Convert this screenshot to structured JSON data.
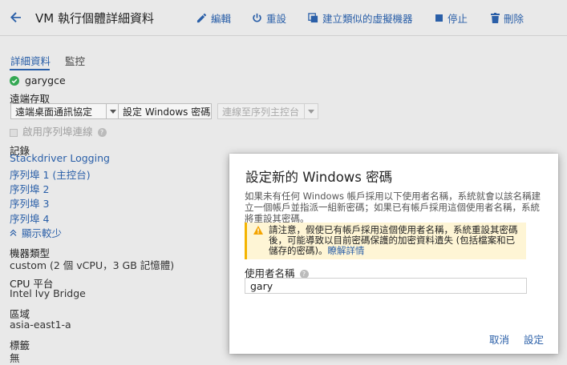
{
  "header": {
    "title": "VM 執行個體詳細資料",
    "actions": [
      {
        "label": "編輯",
        "icon": "pencil-icon"
      },
      {
        "label": "重設",
        "icon": "power-icon"
      },
      {
        "label": "建立類似的虛擬機器",
        "icon": "copy-icon"
      },
      {
        "label": "停止",
        "icon": "stop-icon"
      },
      {
        "label": "刪除",
        "icon": "trash-icon"
      }
    ]
  },
  "tabs": [
    {
      "label": "詳細資料",
      "active": true
    },
    {
      "label": "監控",
      "active": false
    }
  ],
  "instance": {
    "name": "garygce",
    "status_color": "#34a853"
  },
  "remote": {
    "section_label": "遠端存取",
    "rdp_button": "遠端桌面通訊協定",
    "set_password_button": "設定 Windows 密碼",
    "serial_console_button": "連線至序列主控台",
    "serial_checkbox_label": "啟用序列埠連線"
  },
  "logs": {
    "section_label": "記錄",
    "items": [
      "Stackdriver Logging",
      "序列埠 1 (主控台)",
      "序列埠 2",
      "序列埠 3",
      "序列埠 4"
    ],
    "show_less": "顯示較少"
  },
  "machine": {
    "label": "機器類型",
    "value": "custom (2 個 vCPU，3 GB 記憶體)"
  },
  "cpu": {
    "label": "CPU 平台",
    "value": "Intel Ivy Bridge"
  },
  "zone": {
    "label": "區域",
    "value": "asia-east1-a"
  },
  "labels": {
    "label": "標籤",
    "value": "無"
  },
  "dialog": {
    "title": "設定新的 Windows 密碼",
    "description": "如果未有任何 Windows 帳戶採用以下使用者名稱，系統就會以該名稱建立一個帳戶並指派一組新密碼；如果已有帳戶採用這個使用者名稱，系統將重設其密碼。",
    "warning_text": "請注意，假使已有帳戶採用這個使用者名稱，系統重設其密碼後，可能導致以目前密碼保護的加密資料遺失 (包括檔案和已儲存的密碼)。",
    "learn_more": "瞭解詳情",
    "username_label": "使用者名稱",
    "username_value": "gary",
    "cancel": "取消",
    "confirm": "設定"
  },
  "colors": {
    "accent": "#2a5fa8",
    "warning": "#f4b400",
    "warning_bg": "#fef5d5"
  }
}
